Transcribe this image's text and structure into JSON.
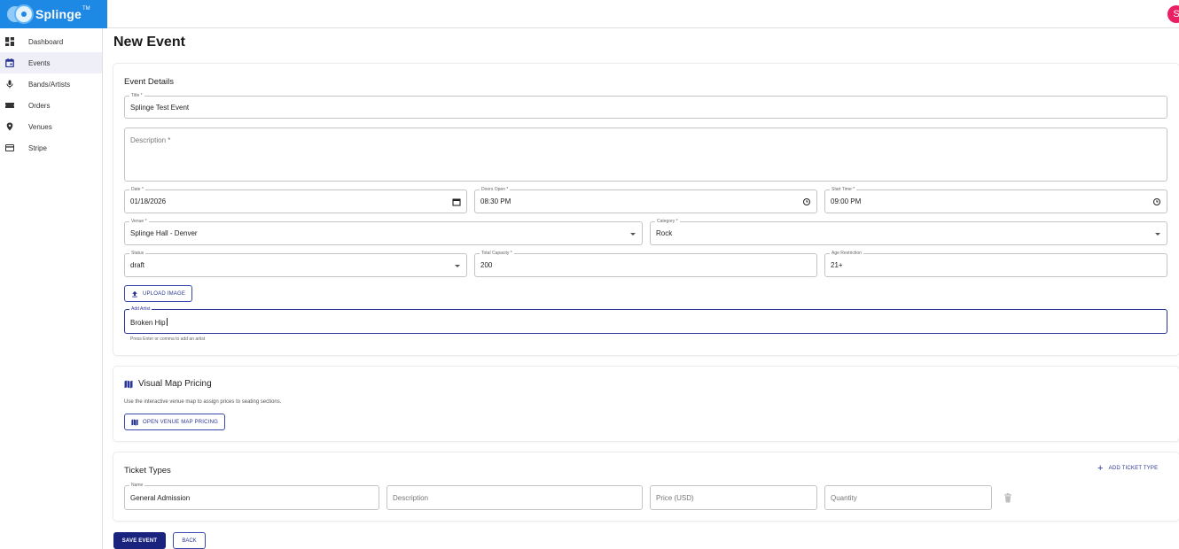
{
  "app": {
    "brand": "Splinge",
    "brand_mark": "TM",
    "avatar_initial": "S",
    "brand_color": "#1e88e5",
    "accent": "#283593"
  },
  "sidebar": {
    "items": [
      {
        "label": "Dashboard",
        "icon": "dashboard-icon",
        "active": false
      },
      {
        "label": "Events",
        "icon": "calendar-icon",
        "active": true
      },
      {
        "label": "Bands/Artists",
        "icon": "microphone-icon",
        "active": false
      },
      {
        "label": "Orders",
        "icon": "ticket-icon",
        "active": false
      },
      {
        "label": "Venues",
        "icon": "location-pin-icon",
        "active": false
      },
      {
        "label": "Stripe",
        "icon": "credit-card-icon",
        "active": false
      }
    ]
  },
  "page": {
    "title": "New Event"
  },
  "event_details": {
    "heading": "Event Details",
    "title_label": "Title *",
    "title_value": "Splinge Test Event",
    "description_label": "Description *",
    "date_label": "Date *",
    "date_value": "01/18/2026",
    "doors_label": "Doors Open *",
    "doors_value": "08:30 PM",
    "start_label": "Start Time *",
    "start_value": "09:00 PM",
    "venue_label": "Venue *",
    "venue_value": "Splinge Hall - Denver",
    "category_label": "Category *",
    "category_value": "Rock",
    "status_label": "Status",
    "status_value": "draft",
    "capacity_label": "Total Capacity *",
    "capacity_value": "200",
    "age_label": "Age Restriction",
    "age_value": "21+",
    "upload_label": "UPLOAD IMAGE",
    "artist_label": "Add Artist",
    "artist_value": "Broken Hip",
    "artist_helper": "Press Enter or comma to add an artist"
  },
  "visual_map": {
    "heading": "Visual Map Pricing",
    "description": "Use the interactive venue map to assign prices to seating sections.",
    "button_label": "OPEN VENUE MAP PRICING"
  },
  "ticket_types": {
    "heading": "Ticket Types",
    "add_label": "ADD TICKET TYPE",
    "name_label": "Name",
    "name_value": "General Admission",
    "description_placeholder": "Description",
    "price_placeholder": "Price (USD)",
    "quantity_placeholder": "Quantity"
  },
  "actions": {
    "save_label": "SAVE EVENT",
    "back_label": "BACK"
  }
}
